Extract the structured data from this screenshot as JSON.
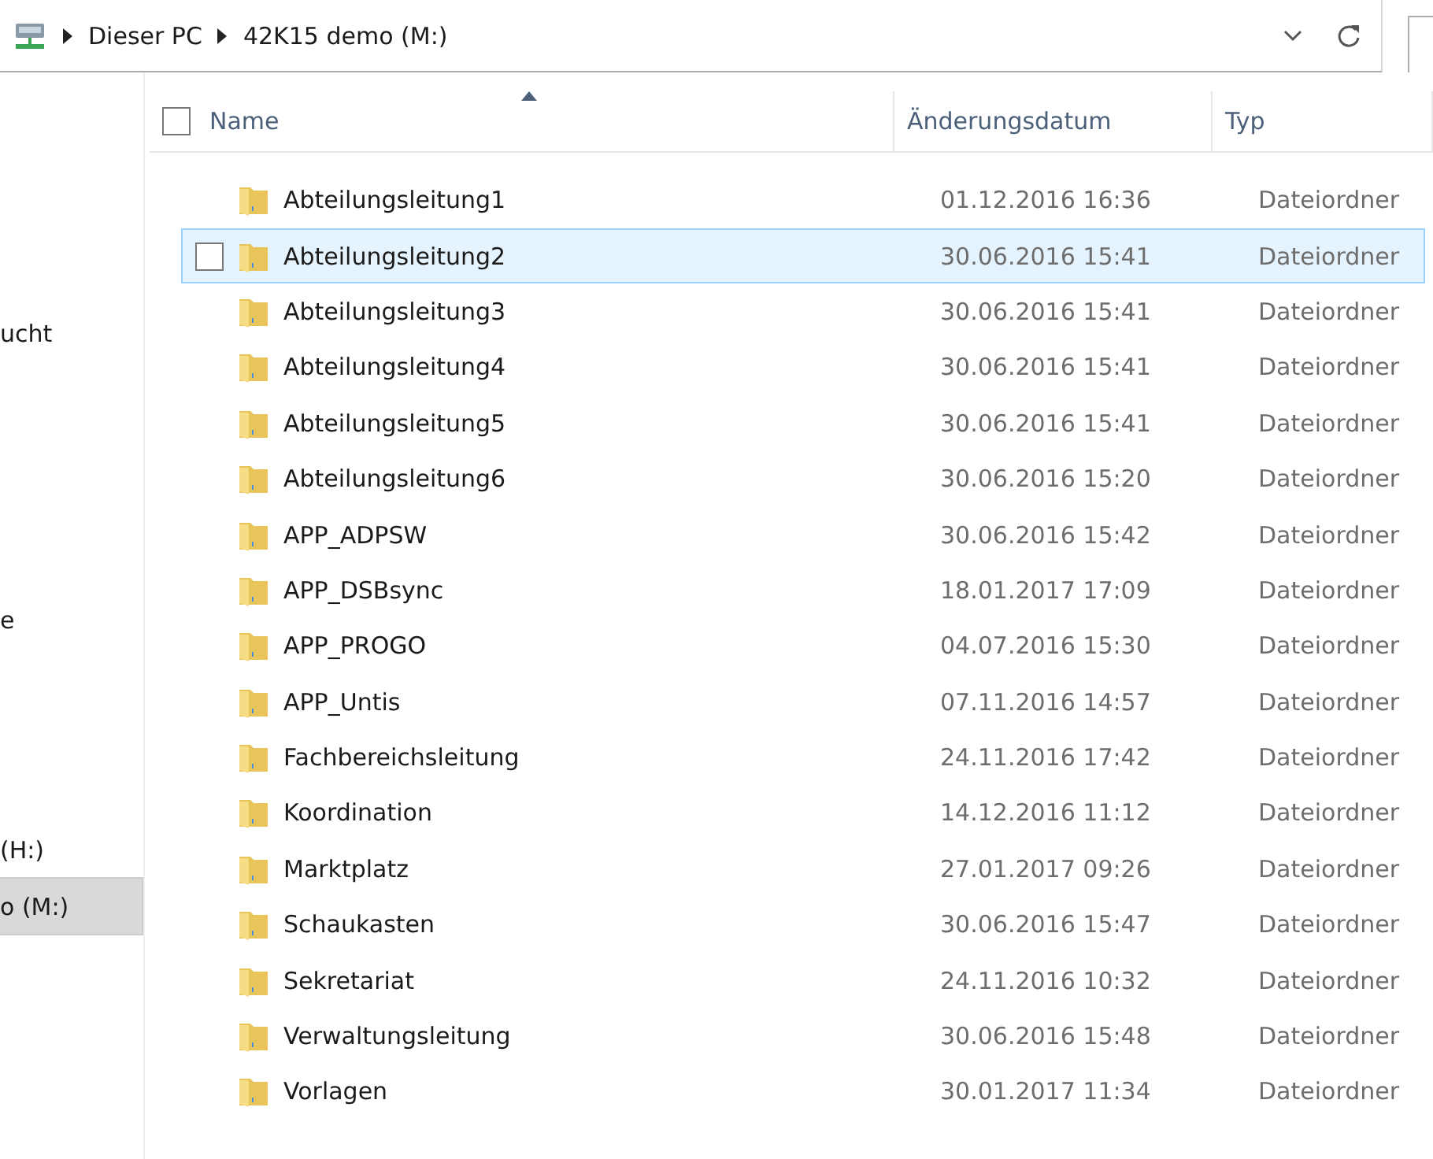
{
  "address_bar": {
    "crumbs": [
      "Dieser PC",
      "42K15 demo (M:)"
    ]
  },
  "sidebar": {
    "items": [
      {
        "label": "ucht",
        "selected": false
      },
      {
        "label": "e",
        "selected": false
      },
      {
        "label": "(H:)",
        "selected": false
      },
      {
        "label": "o (M:)",
        "selected": true
      }
    ]
  },
  "table": {
    "select_all": {
      "checked": false
    },
    "columns": [
      {
        "label": "Name",
        "sorted": true
      },
      {
        "label": "Änderungsdatum",
        "sorted": false
      },
      {
        "label": "Typ",
        "sorted": false
      }
    ],
    "rows": [
      {
        "name": "Abteilungsleitung1",
        "date": "01.12.2016 16:36",
        "type": "Dateiordner",
        "hovered": false
      },
      {
        "name": "Abteilungsleitung2",
        "date": "30.06.2016 15:41",
        "type": "Dateiordner",
        "hovered": true
      },
      {
        "name": "Abteilungsleitung3",
        "date": "30.06.2016 15:41",
        "type": "Dateiordner",
        "hovered": false
      },
      {
        "name": "Abteilungsleitung4",
        "date": "30.06.2016 15:41",
        "type": "Dateiordner",
        "hovered": false
      },
      {
        "name": "Abteilungsleitung5",
        "date": "30.06.2016 15:41",
        "type": "Dateiordner",
        "hovered": false
      },
      {
        "name": "Abteilungsleitung6",
        "date": "30.06.2016 15:20",
        "type": "Dateiordner",
        "hovered": false
      },
      {
        "name": "APP_ADPSW",
        "date": "30.06.2016 15:42",
        "type": "Dateiordner",
        "hovered": false
      },
      {
        "name": "APP_DSBsync",
        "date": "18.01.2017 17:09",
        "type": "Dateiordner",
        "hovered": false
      },
      {
        "name": "APP_PROGO",
        "date": "04.07.2016 15:30",
        "type": "Dateiordner",
        "hovered": false
      },
      {
        "name": "APP_Untis",
        "date": "07.11.2016 14:57",
        "type": "Dateiordner",
        "hovered": false
      },
      {
        "name": "Fachbereichsleitung",
        "date": "24.11.2016 17:42",
        "type": "Dateiordner",
        "hovered": false
      },
      {
        "name": "Koordination",
        "date": "14.12.2016 11:12",
        "type": "Dateiordner",
        "hovered": false
      },
      {
        "name": "Marktplatz",
        "date": "27.01.2017 09:26",
        "type": "Dateiordner",
        "hovered": false
      },
      {
        "name": "Schaukasten",
        "date": "30.06.2016 15:47",
        "type": "Dateiordner",
        "hovered": false
      },
      {
        "name": "Sekretariat",
        "date": "24.11.2016 10:32",
        "type": "Dateiordner",
        "hovered": false
      },
      {
        "name": "Verwaltungsleitung",
        "date": "30.06.2016 15:48",
        "type": "Dateiordner",
        "hovered": false
      },
      {
        "name": "Vorlagen",
        "date": "30.01.2017 11:34",
        "type": "Dateiordner",
        "hovered": false
      }
    ]
  }
}
